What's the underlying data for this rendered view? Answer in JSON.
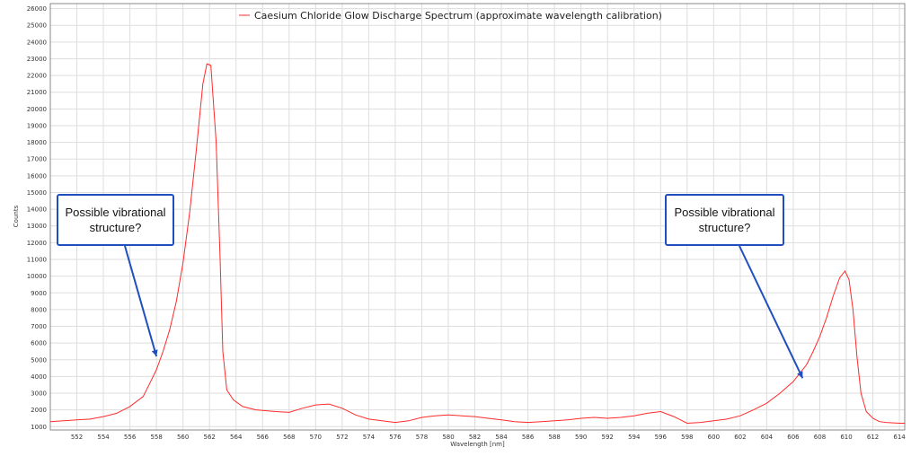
{
  "chart_data": {
    "type": "line",
    "legend": "Caesium Chloride Glow Discharge Spectrum (approximate wavelength calibration)",
    "legend_position": "top-center",
    "xlabel": "Wavelength [nm]",
    "ylabel": "Counts",
    "xlim": [
      550.0,
      614.4
    ],
    "ylim": [
      800,
      26300
    ],
    "grid": true,
    "line_color": "#ff2a2a",
    "x_ticks": [
      552,
      554,
      556,
      558,
      560,
      562,
      564,
      566,
      568,
      570,
      572,
      574,
      576,
      578,
      580,
      582,
      584,
      586,
      588,
      590,
      592,
      594,
      596,
      598,
      600,
      602,
      604,
      606,
      608,
      610,
      612,
      614
    ],
    "y_ticks": [
      1000,
      2000,
      3000,
      4000,
      5000,
      6000,
      7000,
      8000,
      9000,
      10000,
      11000,
      12000,
      13000,
      14000,
      15000,
      16000,
      17000,
      18000,
      19000,
      20000,
      21000,
      22000,
      23000,
      24000,
      25000,
      26000
    ],
    "series": [
      {
        "name": "Caesium Chloride Glow Discharge Spectrum (approximate wavelength calibration)",
        "points": [
          [
            550.0,
            1300
          ],
          [
            551.0,
            1350
          ],
          [
            552.0,
            1400
          ],
          [
            553.0,
            1450
          ],
          [
            554.0,
            1600
          ],
          [
            555.0,
            1800
          ],
          [
            556.0,
            2200
          ],
          [
            557.0,
            2800
          ],
          [
            557.5,
            3600
          ],
          [
            558.0,
            4400
          ],
          [
            558.5,
            5500
          ],
          [
            559.0,
            6800
          ],
          [
            559.5,
            8500
          ],
          [
            560.0,
            10800
          ],
          [
            560.5,
            13800
          ],
          [
            561.0,
            17500
          ],
          [
            561.5,
            21500
          ],
          [
            561.8,
            22700
          ],
          [
            562.1,
            22600
          ],
          [
            562.5,
            18000
          ],
          [
            562.8,
            11000
          ],
          [
            563.0,
            5500
          ],
          [
            563.3,
            3200
          ],
          [
            563.8,
            2600
          ],
          [
            564.5,
            2200
          ],
          [
            565.5,
            2000
          ],
          [
            567.0,
            1900
          ],
          [
            568.0,
            1850
          ],
          [
            569.0,
            2100
          ],
          [
            570.0,
            2300
          ],
          [
            571.0,
            2350
          ],
          [
            572.0,
            2100
          ],
          [
            573.0,
            1700
          ],
          [
            574.0,
            1450
          ],
          [
            575.0,
            1350
          ],
          [
            576.0,
            1250
          ],
          [
            577.0,
            1350
          ],
          [
            578.0,
            1550
          ],
          [
            579.0,
            1650
          ],
          [
            580.0,
            1700
          ],
          [
            581.0,
            1650
          ],
          [
            582.0,
            1600
          ],
          [
            583.0,
            1500
          ],
          [
            584.0,
            1400
          ],
          [
            585.0,
            1300
          ],
          [
            586.0,
            1250
          ],
          [
            587.0,
            1300
          ],
          [
            588.0,
            1350
          ],
          [
            589.0,
            1400
          ],
          [
            590.0,
            1500
          ],
          [
            591.0,
            1550
          ],
          [
            592.0,
            1500
          ],
          [
            593.0,
            1550
          ],
          [
            594.0,
            1650
          ],
          [
            595.0,
            1800
          ],
          [
            596.0,
            1900
          ],
          [
            597.0,
            1600
          ],
          [
            598.0,
            1200
          ],
          [
            599.0,
            1250
          ],
          [
            600.0,
            1350
          ],
          [
            601.0,
            1450
          ],
          [
            602.0,
            1650
          ],
          [
            603.0,
            2000
          ],
          [
            604.0,
            2400
          ],
          [
            605.0,
            3000
          ],
          [
            606.0,
            3700
          ],
          [
            606.5,
            4200
          ],
          [
            607.0,
            4700
          ],
          [
            607.5,
            5500
          ],
          [
            608.0,
            6400
          ],
          [
            608.5,
            7500
          ],
          [
            609.0,
            8800
          ],
          [
            609.5,
            9900
          ],
          [
            609.9,
            10300
          ],
          [
            610.2,
            9800
          ],
          [
            610.5,
            8000
          ],
          [
            610.8,
            5200
          ],
          [
            611.1,
            3000
          ],
          [
            611.5,
            1900
          ],
          [
            612.0,
            1500
          ],
          [
            612.5,
            1300
          ],
          [
            613.0,
            1250
          ],
          [
            614.0,
            1200
          ],
          [
            614.4,
            1200
          ]
        ]
      }
    ],
    "annotations": [
      {
        "text": "Possible vibrational structure?",
        "arrow_to": [
          558.0,
          5200
        ]
      },
      {
        "text": "Possible vibrational structure?",
        "arrow_to": [
          606.7,
          3900
        ]
      }
    ]
  }
}
